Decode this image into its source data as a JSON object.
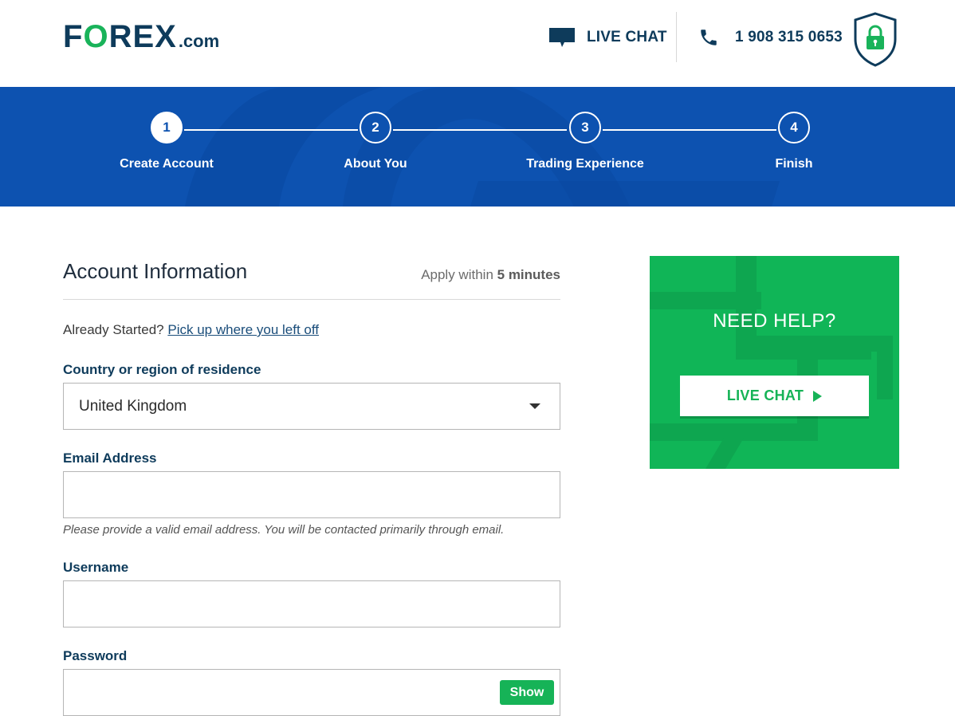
{
  "header": {
    "logo_main_pre": "F",
    "logo_main_o": "O",
    "logo_main_post": "REX",
    "logo_suffix": ".com",
    "live_chat_label": "LIVE CHAT",
    "phone": "1 908 315 0653",
    "icons": [
      "chat-bubble-icon",
      "phone-icon",
      "shield-lock-icon"
    ]
  },
  "steps": [
    {
      "number": "1",
      "label": "Create Account",
      "active": true
    },
    {
      "number": "2",
      "label": "About You",
      "active": false
    },
    {
      "number": "3",
      "label": "Trading Experience",
      "active": false
    },
    {
      "number": "4",
      "label": "Finish",
      "active": false
    }
  ],
  "form": {
    "title": "Account Information",
    "apply_prefix": "Apply within",
    "apply_bold": "5 minutes",
    "already_prefix": "Already Started?",
    "already_link": "Pick up where you left off",
    "country_label": "Country or region of residence",
    "country_value": "United Kingdom",
    "email_label": "Email Address",
    "email_value": "",
    "email_hint": "Please provide a valid email address. You will be contacted primarily through email.",
    "username_label": "Username",
    "username_value": "",
    "password_label": "Password",
    "password_value": "",
    "show_label": "Show"
  },
  "help": {
    "title": "NEED HELP?",
    "button_label": "LIVE CHAT"
  },
  "colors": {
    "brand_navy": "#0e3b5b",
    "brand_green": "#16b357",
    "banner_blue": "#0d52b0"
  }
}
